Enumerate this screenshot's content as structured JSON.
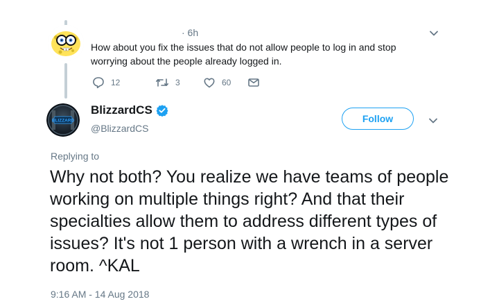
{
  "top_cutoff_text": "           ",
  "reply": {
    "time": "· 6h",
    "text": "How about you fix the issues that do not allow people to log in and stop worrying about the people already logged in.",
    "actions": {
      "replies": "12",
      "retweets": "3",
      "likes": "60"
    }
  },
  "main_tweet": {
    "display_name": "BlizzardCS",
    "handle": "@BlizzardCS",
    "follow_label": "Follow",
    "replying_to": "Replying to",
    "text": "Why not both? You realize we have teams of people working on multiple things right? And that their specialties allow them to address different types of issues? It's not 1 person with a wrench in a server room. ^KAL",
    "timestamp": "9:16 AM - 14 Aug 2018",
    "avatar_text": "BLIZZARD"
  },
  "colors": {
    "accent": "#1da1f2",
    "secondary_text": "#657786",
    "thread_line": "#c4cfd6"
  },
  "icons": {
    "reply": "reply-icon",
    "retweet": "retweet-icon",
    "like": "heart-icon",
    "dm": "envelope-icon",
    "verified": "verified-badge-icon",
    "caret": "chevron-down-icon"
  }
}
